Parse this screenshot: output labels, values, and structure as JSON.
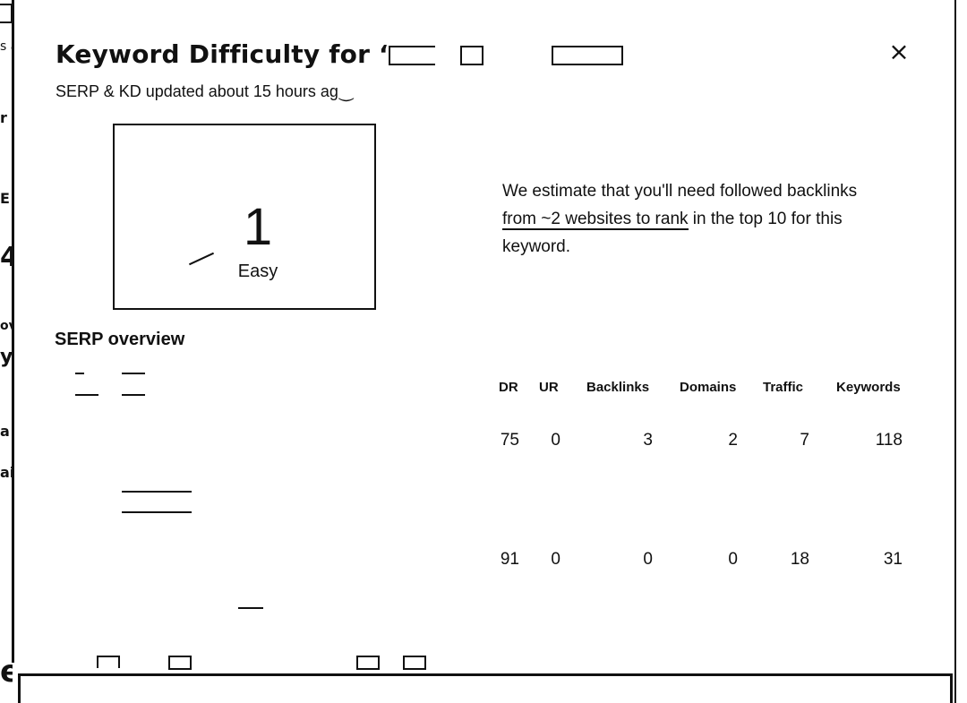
{
  "background": {
    "fragments": [
      "s a",
      "r",
      "E",
      "4",
      "ov",
      "y",
      "a",
      "ai",
      "e"
    ]
  },
  "modal": {
    "title_prefix": "Keyword Difficulty for ‘",
    "subtitle": "SERP & KD updated about 15 hours ag⏝",
    "close_icon": "×",
    "kd": {
      "score": "1",
      "label": "Easy"
    },
    "estimate": {
      "line1": "We estimate that you'll need followed backlinks",
      "line2_underlined": "from ~2 websites to rank",
      "line2_rest": " in the top 10 for this",
      "line3": "keyword."
    },
    "serp": {
      "title": "SERP overview",
      "columns": [
        "DR",
        "UR",
        "Backlinks",
        "Domains",
        "Traffic",
        "Keywords"
      ],
      "rows": [
        {
          "dr": "75",
          "ur": "0",
          "backlinks": "3",
          "domains": "2",
          "traffic": "7",
          "keywords": "118"
        },
        {
          "dr": "91",
          "ur": "0",
          "backlinks": "0",
          "domains": "0",
          "traffic": "18",
          "keywords": "31"
        }
      ]
    }
  }
}
